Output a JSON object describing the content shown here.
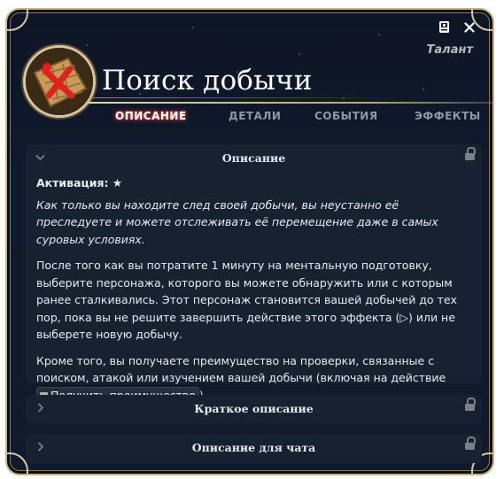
{
  "window": {
    "type_label": "Талант",
    "icons": [
      "book-icon",
      "close-icon"
    ]
  },
  "header": {
    "title": "Поиск добычи"
  },
  "tabs": [
    {
      "label": "ОПИСАНИЕ",
      "active": true
    },
    {
      "label": "ДЕТАЛИ",
      "active": false
    },
    {
      "label": "СОБЫТИЯ",
      "active": false
    },
    {
      "label": "ЭФФЕКТЫ",
      "active": false
    }
  ],
  "description_panel": {
    "title": "Описание",
    "activation_label": "Активация: ★",
    "flavor": "Как только вы находите след своей добычи, вы неустанно её преследуете и можете отслеживать её перемещение даже в самых суровых условиях.",
    "paragraph1": "После того как вы потратите 1 минуту на ментальную подготовку, выберите персонажа, которого вы можете обнаружить или с которым ранее сталкивались. Этот персонаж становится вашей добычей до тех пор, пока вы не решите завершить действие этого эффекта (▷) или не выберете новую добычу.",
    "paragraph2_before": "Кроме того, вы получаете преимущество на проверки, связанные с поиском, атакой или изучением вашей добычи (включая на действие",
    "action_chip": "Получить преимущество",
    "paragraph2_after": ")."
  },
  "short_description_panel": {
    "title": "Краткое описание"
  },
  "chat_description_panel": {
    "title": "Описание для чата"
  },
  "colors": {
    "background": "#111a2a",
    "panel": "#182131",
    "gold_border": "#c9b48a",
    "active_tab_glow": "#ff3a2a"
  }
}
